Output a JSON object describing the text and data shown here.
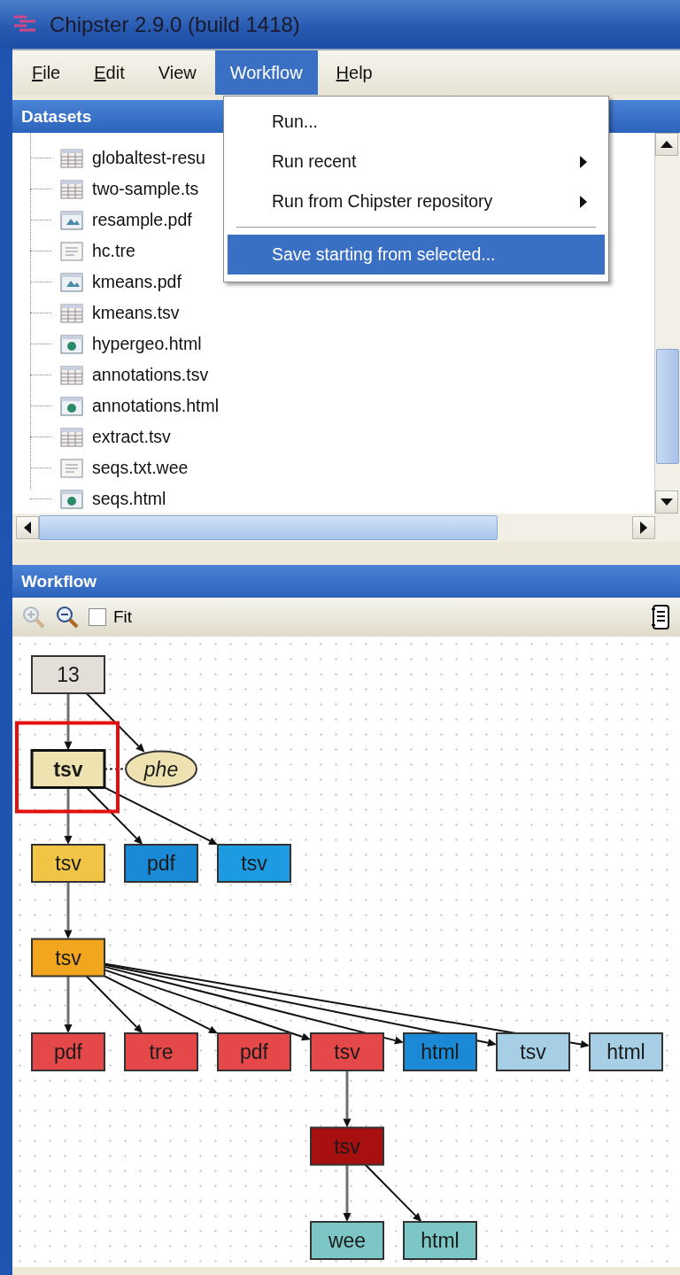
{
  "window": {
    "title": "Chipster 2.9.0 (build 1418)"
  },
  "menu_bar": [
    {
      "label": "File",
      "underline_first": true,
      "selected": false
    },
    {
      "label": "Edit",
      "underline_first": true,
      "selected": false
    },
    {
      "label": "View",
      "underline_first": false,
      "selected": false
    },
    {
      "label": "Workflow",
      "underline_first": false,
      "selected": true
    },
    {
      "label": "Help",
      "underline_first": true,
      "selected": false
    }
  ],
  "open_menu": {
    "items": [
      {
        "label": "Run...",
        "submenu": false,
        "separator_before": false,
        "selected": false
      },
      {
        "label": "Run recent",
        "submenu": true,
        "separator_before": false,
        "selected": false
      },
      {
        "label": "Run from Chipster repository",
        "submenu": true,
        "separator_before": false,
        "selected": false
      },
      {
        "label": "Save starting from selected...",
        "submenu": false,
        "separator_before": true,
        "selected": true
      }
    ]
  },
  "datasets": {
    "title": "Datasets",
    "items": [
      {
        "name": "globaltest-resu",
        "kind": "table"
      },
      {
        "name": "two-sample.ts",
        "kind": "table"
      },
      {
        "name": "resample.pdf",
        "kind": "image"
      },
      {
        "name": "hc.tre",
        "kind": "text"
      },
      {
        "name": "kmeans.pdf",
        "kind": "image"
      },
      {
        "name": "kmeans.tsv",
        "kind": "table"
      },
      {
        "name": "hypergeo.html",
        "kind": "html"
      },
      {
        "name": "annotations.tsv",
        "kind": "table"
      },
      {
        "name": "annotations.html",
        "kind": "html"
      },
      {
        "name": "extract.tsv",
        "kind": "table"
      },
      {
        "name": "seqs.txt.wee",
        "kind": "text"
      },
      {
        "name": "seqs.html",
        "kind": "html"
      }
    ]
  },
  "workflow": {
    "title": "Workflow",
    "toolbar": {
      "zoom_in": {
        "disabled": true
      },
      "zoom_out": {
        "disabled": false
      },
      "fit": {
        "label": "Fit",
        "checked": false
      }
    },
    "nodes": [
      {
        "label": "13",
        "kind": "dataset",
        "color": "#e4ded8",
        "selected": false,
        "children": [
          {
            "label": "tsv",
            "kind": "dataset",
            "color": "#eee3b0",
            "selected": true,
            "children": [
              {
                "label": "tsv",
                "kind": "dataset",
                "color": "#f0c445",
                "selected": false,
                "children": [
                  {
                    "label": "tsv",
                    "kind": "dataset",
                    "color": "#f2a51e",
                    "selected": false,
                    "children": [
                      {
                        "label": "pdf",
                        "kind": "dataset",
                        "color": "#e54848",
                        "selected": false
                      },
                      {
                        "label": "tre",
                        "kind": "dataset",
                        "color": "#e54848",
                        "selected": false
                      },
                      {
                        "label": "pdf",
                        "kind": "dataset",
                        "color": "#e54848",
                        "selected": false
                      },
                      {
                        "label": "tsv",
                        "kind": "dataset",
                        "color": "#e54848",
                        "selected": false,
                        "children": [
                          {
                            "label": "tsv",
                            "kind": "dataset",
                            "color": "#a81010",
                            "selected": false,
                            "children": [
                              {
                                "label": "wee",
                                "kind": "dataset",
                                "color": "#7cc6c6",
                                "selected": false
                              },
                              {
                                "label": "html",
                                "kind": "dataset",
                                "color": "#7cc6c6",
                                "selected": false
                              }
                            ]
                          }
                        ]
                      },
                      {
                        "label": "html",
                        "kind": "dataset",
                        "color": "#1a8ad6",
                        "selected": false
                      },
                      {
                        "label": "tsv",
                        "kind": "dataset",
                        "color": "#a6cfe6",
                        "selected": false
                      },
                      {
                        "label": "html",
                        "kind": "dataset",
                        "color": "#a6cfe6",
                        "selected": false
                      }
                    ]
                  }
                ]
              },
              {
                "label": "pdf",
                "kind": "dataset",
                "color": "#1a8ad6",
                "selected": false
              },
              {
                "label": "tsv",
                "kind": "dataset",
                "color": "#1c9be2",
                "selected": false
              }
            ]
          },
          {
            "label": "phe",
            "kind": "phenodata",
            "color": "#eee3b0",
            "selected": false
          }
        ]
      }
    ]
  }
}
